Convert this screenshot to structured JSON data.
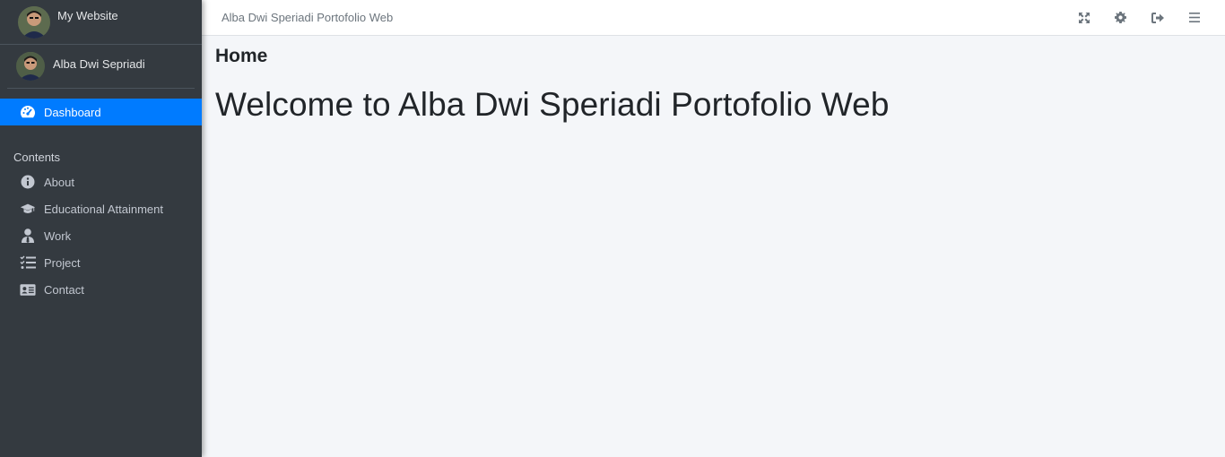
{
  "brand": {
    "text": "My Website"
  },
  "user": {
    "name": "Alba Dwi Sepriadi"
  },
  "sidebar": {
    "active_item": {
      "label": "Dashboard",
      "icon": "tachometer-icon"
    },
    "section_header": "Contents",
    "items": [
      {
        "label": "About",
        "icon": "info-circle-icon"
      },
      {
        "label": "Educational Attainment",
        "icon": "graduation-cap-icon"
      },
      {
        "label": "Work",
        "icon": "user-tie-icon"
      },
      {
        "label": "Project",
        "icon": "tasks-icon"
      },
      {
        "label": "Contact",
        "icon": "address-card-icon"
      }
    ]
  },
  "topbar": {
    "title": "Alba Dwi Speriadi Portofolio Web",
    "actions": [
      "fullscreen-icon",
      "gear-icon",
      "sign-out-icon",
      "menu-icon"
    ]
  },
  "main": {
    "page_title": "Home",
    "heading": "Welcome to Alba Dwi Speriadi Portofolio Web"
  },
  "colors": {
    "sidebar_bg": "#343a40",
    "active_bg": "#007bff",
    "content_bg": "#f4f6f9"
  }
}
